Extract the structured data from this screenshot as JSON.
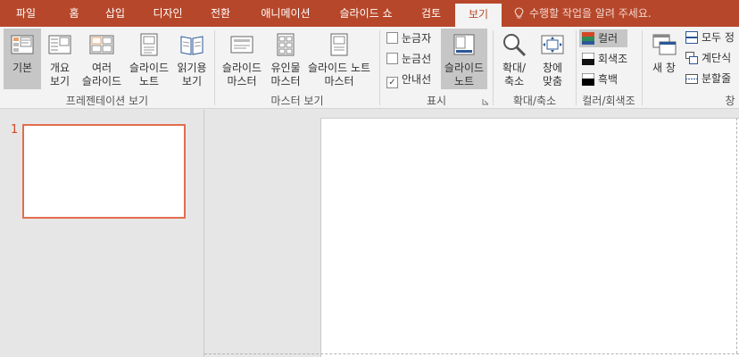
{
  "colors": {
    "accent": "#b7472a",
    "ribbon_bg": "#f3f3f3",
    "selected_bg": "#c6c6c6",
    "thumb_border": "#e36c4f"
  },
  "tabs": [
    {
      "id": "file",
      "label": "파일"
    },
    {
      "id": "home",
      "label": "홈"
    },
    {
      "id": "insert",
      "label": "삽입"
    },
    {
      "id": "design",
      "label": "디자인"
    },
    {
      "id": "transitions",
      "label": "전환"
    },
    {
      "id": "animations",
      "label": "애니메이션"
    },
    {
      "id": "slideshow",
      "label": "슬라이드 쇼"
    },
    {
      "id": "review",
      "label": "검토"
    },
    {
      "id": "view",
      "label": "보기",
      "active": true
    }
  ],
  "tell_me": {
    "icon": "lightbulb-icon",
    "placeholder": "수행할 작업을 알려 주세요."
  },
  "ribbon": {
    "presentation_views": {
      "label": "프레젠테이션 보기",
      "buttons": [
        {
          "line1": "기본",
          "line2": "",
          "icon": "normal-view-icon",
          "selected": true
        },
        {
          "line1": "개요",
          "line2": "보기",
          "icon": "outline-view-icon"
        },
        {
          "line1": "여러",
          "line2": "슬라이드",
          "icon": "slide-sorter-icon"
        },
        {
          "line1": "슬라이드",
          "line2": "노트",
          "icon": "notes-page-icon"
        },
        {
          "line1": "읽기용",
          "line2": "보기",
          "icon": "reading-view-icon"
        }
      ]
    },
    "master_views": {
      "label": "마스터 보기",
      "buttons": [
        {
          "line1": "슬라이드",
          "line2": "마스터",
          "icon": "slide-master-icon"
        },
        {
          "line1": "유인물",
          "line2": "마스터",
          "icon": "handout-master-icon"
        },
        {
          "line1": "슬라이드 노트",
          "line2": "마스터",
          "icon": "notes-master-icon"
        }
      ]
    },
    "show": {
      "label": "표시",
      "checks": [
        {
          "label": "눈금자",
          "checked": false
        },
        {
          "label": "눈금선",
          "checked": false
        },
        {
          "label": "안내선",
          "checked": true
        }
      ],
      "notes_button": {
        "line1": "슬라이드",
        "line2": "노트",
        "icon": "notes-icon",
        "selected": true
      }
    },
    "zoom": {
      "label": "확대/축소",
      "buttons": [
        {
          "line1": "확대/",
          "line2": "축소",
          "icon": "zoom-icon"
        },
        {
          "line1": "창에",
          "line2": "맞춤",
          "icon": "fit-to-window-icon"
        }
      ]
    },
    "color_grayscale": {
      "label": "컬러/회색조",
      "items": [
        {
          "label": "컬러",
          "icon": "color-swatch-icon",
          "selected": true
        },
        {
          "label": "회색조",
          "icon": "grayscale-swatch-icon"
        },
        {
          "label": "흑백",
          "icon": "black-white-swatch-icon"
        }
      ]
    },
    "window": {
      "label": "창",
      "new_window": "새 창",
      "items": [
        {
          "label": "모두 정",
          "icon": "arrange-all-icon"
        },
        {
          "label": "계단식",
          "icon": "cascade-icon"
        },
        {
          "label": "분할줄",
          "icon": "move-split-icon"
        }
      ]
    }
  },
  "slides": [
    {
      "number": "1"
    }
  ]
}
